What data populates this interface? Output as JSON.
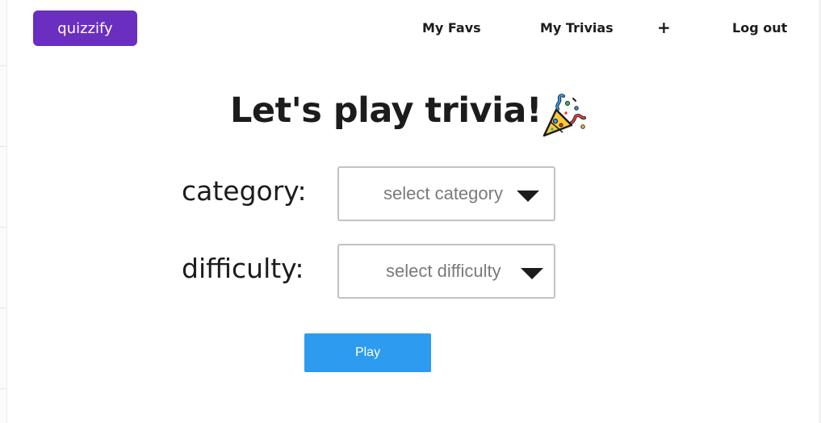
{
  "header": {
    "logo_label": "quizzify",
    "nav": {
      "favs_label": "My Favs",
      "trivias_label": "My Trivias",
      "add_label": "+",
      "logout_label": "Log out"
    }
  },
  "main": {
    "heading": "Let's play trivia!",
    "heading_icon": "party-popper-icon",
    "category": {
      "label": "category:",
      "placeholder": "select category"
    },
    "difficulty": {
      "label": "difficulty:",
      "placeholder": "select difficulty"
    },
    "play_label": "Play"
  },
  "colors": {
    "brand": "#6a2ec0",
    "play_button": "#2d9bef",
    "text": "#1c1c1c",
    "placeholder": "#7a7a7a",
    "select_border": "#c2c2c2"
  }
}
